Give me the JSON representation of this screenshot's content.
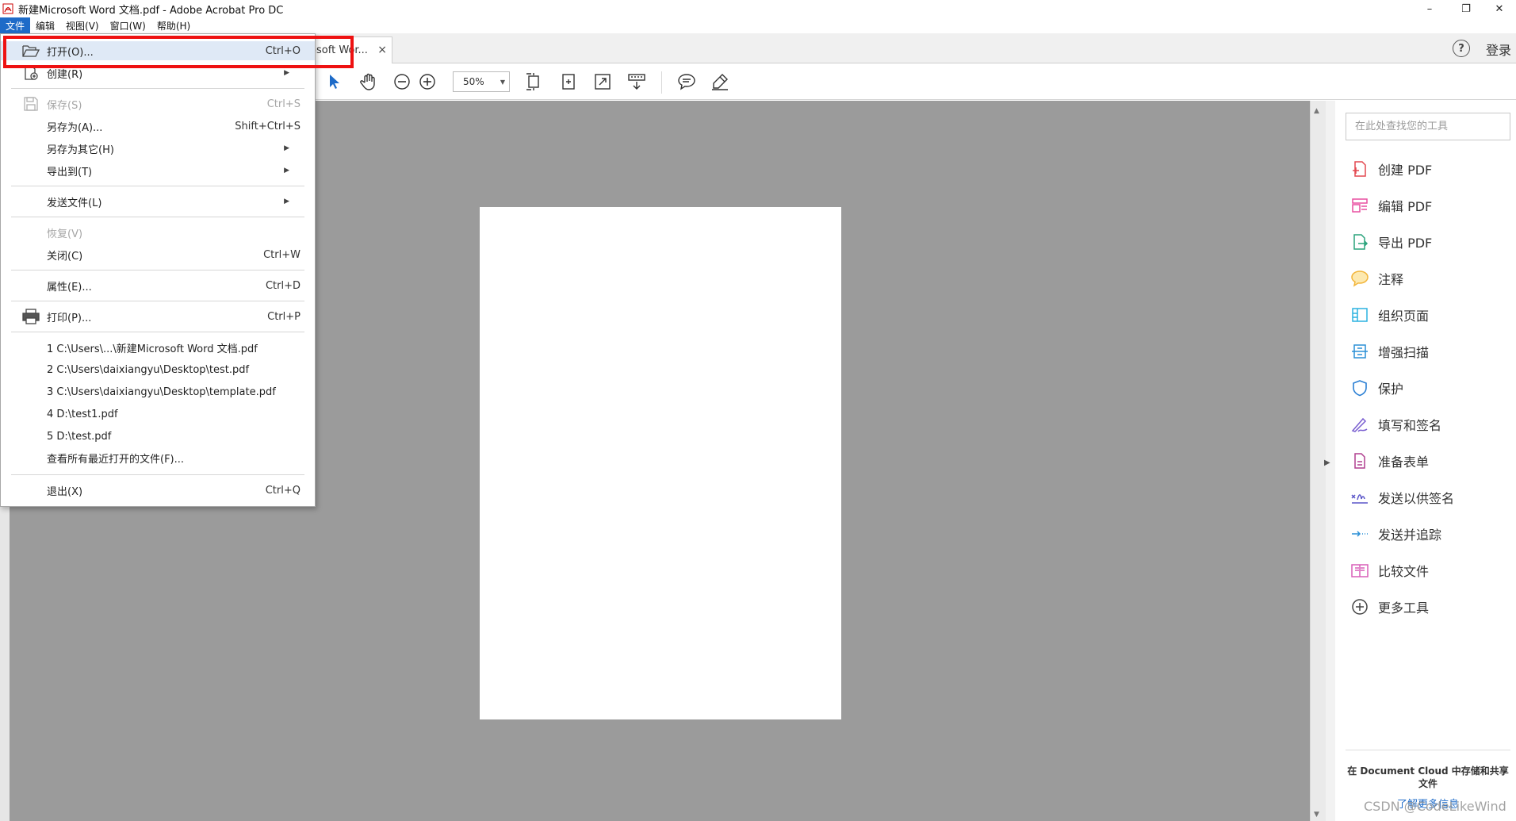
{
  "window": {
    "title": "新建Microsoft Word 文档.pdf - Adobe Acrobat Pro DC",
    "minimize": "–",
    "restore": "❐",
    "close": "✕"
  },
  "menubar": [
    {
      "label": "文件",
      "active": true
    },
    {
      "label": "编辑"
    },
    {
      "label": "视图(V)"
    },
    {
      "label": "窗口(W)"
    },
    {
      "label": "帮助(H)"
    }
  ],
  "tab": {
    "label": "rosoft Wor...",
    "close": "×"
  },
  "header_right": {
    "help": "?",
    "login": "登录"
  },
  "toolbar": {
    "zoom": "50%",
    "icons": [
      "select-arrow-icon",
      "hand-icon",
      "zoom-out-icon",
      "zoom-in-icon",
      "fit-page-icon",
      "rotate-view-icon",
      "full-screen-icon",
      "scroll-mode-icon",
      "comment-icon",
      "highlight-pen-icon"
    ]
  },
  "file_menu": {
    "items": {
      "open": {
        "label": "打开(O)...",
        "shortcut": "Ctrl+O"
      },
      "create": {
        "label": "创建(R)"
      },
      "save": {
        "label": "保存(S)",
        "shortcut": "Ctrl+S"
      },
      "save_as": {
        "label": "另存为(A)...",
        "shortcut": "Shift+Ctrl+S"
      },
      "save_as_other": {
        "label": "另存为其它(H)"
      },
      "export_to": {
        "label": "导出到(T)"
      },
      "send_file": {
        "label": "发送文件(L)"
      },
      "revert": {
        "label": "恢复(V)"
      },
      "close": {
        "label": "关闭(C)",
        "shortcut": "Ctrl+W"
      },
      "properties": {
        "label": "属性(E)...",
        "shortcut": "Ctrl+D"
      },
      "print": {
        "label": "打印(P)...",
        "shortcut": "Ctrl+P"
      },
      "recent1": {
        "label": "1 C:\\Users\\...\\新建Microsoft Word 文档.pdf"
      },
      "recent2": {
        "label": "2 C:\\Users\\daixiangyu\\Desktop\\test.pdf"
      },
      "recent3": {
        "label": "3 C:\\Users\\daixiangyu\\Desktop\\template.pdf"
      },
      "recent4": {
        "label": "4 D:\\test1.pdf"
      },
      "recent5": {
        "label": "5 D:\\test.pdf"
      },
      "view_all_recent": {
        "label": "查看所有最近打开的文件(F)..."
      },
      "exit": {
        "label": "退出(X)",
        "shortcut": "Ctrl+Q"
      }
    }
  },
  "tools_panel": {
    "search_placeholder": "在此处查找您的工具",
    "tools": [
      {
        "label": "创建 PDF",
        "icon": "create-pdf-icon",
        "color": "#e34850"
      },
      {
        "label": "编辑 PDF",
        "icon": "edit-pdf-icon",
        "color": "#e94fa0"
      },
      {
        "label": "导出 PDF",
        "icon": "export-pdf-icon",
        "color": "#2aa37c"
      },
      {
        "label": "注释",
        "icon": "comment-icon",
        "color": "#f2b53a"
      },
      {
        "label": "组织页面",
        "icon": "organize-pages-icon",
        "color": "#2bb2e0"
      },
      {
        "label": "增强扫描",
        "icon": "enhance-scan-icon",
        "color": "#2a8fd6"
      },
      {
        "label": "保护",
        "icon": "protect-icon",
        "color": "#2a7fd4"
      },
      {
        "label": "填写和签名",
        "icon": "fill-sign-icon",
        "color": "#7a5fd0"
      },
      {
        "label": "准备表单",
        "icon": "prepare-form-icon",
        "color": "#b03f8f"
      },
      {
        "label": "发送以供签名",
        "icon": "send-for-signature-icon",
        "color": "#5a55c8"
      },
      {
        "label": "发送并追踪",
        "icon": "send-track-icon",
        "color": "#2a8fd6"
      },
      {
        "label": "比较文件",
        "icon": "compare-files-icon",
        "color": "#d85fb8"
      },
      {
        "label": "更多工具",
        "icon": "more-tools-icon",
        "color": "#444444"
      }
    ],
    "cloud_text": "在 Document Cloud 中存储和共享文件",
    "cloud_link": "了解更多信息"
  },
  "watermark": "CSDN @CodeLikeWind",
  "colors": {
    "accent": "#1e6bc8",
    "highlight_box": "#ee1111",
    "doc_background": "#9b9b9b"
  }
}
